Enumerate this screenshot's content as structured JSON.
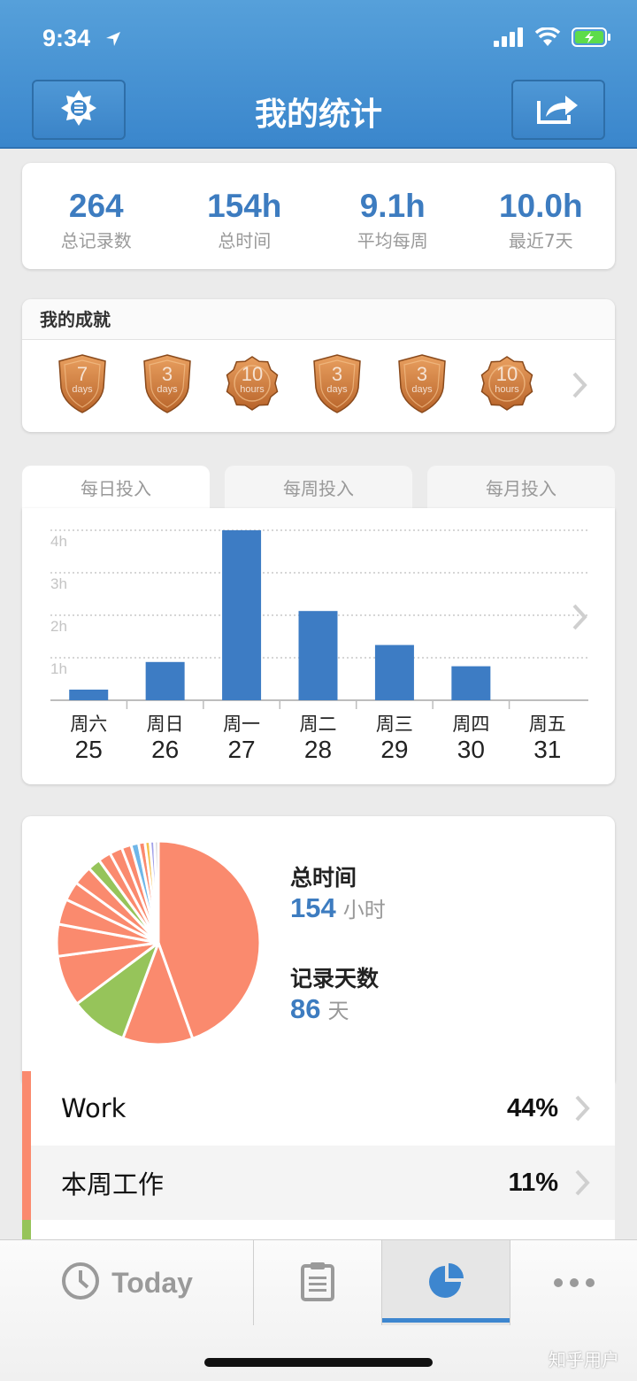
{
  "status": {
    "time": "9:34"
  },
  "header": {
    "title": "我的统计"
  },
  "summary": [
    {
      "value": "264",
      "label": "总记录数"
    },
    {
      "value": "154h",
      "label": "总时间"
    },
    {
      "value": "9.1h",
      "label": "平均每周"
    },
    {
      "value": "10.0h",
      "label": "最近7天"
    }
  ],
  "achievements": {
    "title": "我的成就",
    "badges": [
      {
        "kind": "shield",
        "num": "7",
        "unit": "days"
      },
      {
        "kind": "shield",
        "num": "3",
        "unit": "days"
      },
      {
        "kind": "seal",
        "num": "10",
        "unit": "hours"
      },
      {
        "kind": "shield",
        "num": "3",
        "unit": "days"
      },
      {
        "kind": "shield",
        "num": "3",
        "unit": "days"
      },
      {
        "kind": "seal",
        "num": "10",
        "unit": "hours"
      }
    ]
  },
  "tabs": [
    {
      "label": "每日投入",
      "active": true
    },
    {
      "label": "每周投入",
      "active": false
    },
    {
      "label": "每月投入",
      "active": false
    }
  ],
  "chart_data": {
    "type": "bar",
    "categories": [
      "周六",
      "周日",
      "周一",
      "周二",
      "周三",
      "周四",
      "周五"
    ],
    "dates": [
      "25",
      "26",
      "27",
      "28",
      "29",
      "30",
      "31"
    ],
    "values": [
      0.25,
      0.9,
      4.0,
      2.1,
      1.3,
      0.8,
      0
    ],
    "ylim": [
      0,
      4
    ],
    "yticks": [
      "1h",
      "2h",
      "3h",
      "4h"
    ],
    "grid": true,
    "bar_color": "#3d7cc4"
  },
  "pie": {
    "total_label": "总时间",
    "total_value": "154",
    "total_unit": "小时",
    "days_label": "记录天数",
    "days_value": "86",
    "days_unit": "天",
    "slices": [
      {
        "value": 44,
        "color": "#fa8a6e"
      },
      {
        "value": 11,
        "color": "#fa8a6e"
      },
      {
        "value": 9,
        "color": "#96c45a"
      },
      {
        "value": 8,
        "color": "#fa8a6e"
      },
      {
        "value": 5,
        "color": "#fa8a6e"
      },
      {
        "value": 4,
        "color": "#fa8a6e"
      },
      {
        "value": 3,
        "color": "#fa8a6e"
      },
      {
        "value": 3,
        "color": "#fa8a6e"
      },
      {
        "value": 2,
        "color": "#96c45a"
      },
      {
        "value": 2,
        "color": "#fa8a6e"
      },
      {
        "value": 2,
        "color": "#fa8a6e"
      },
      {
        "value": 1.5,
        "color": "#fa8a6e"
      },
      {
        "value": 1.2,
        "color": "#6fb6e8"
      },
      {
        "value": 1,
        "color": "#fa8a6e"
      },
      {
        "value": 0.8,
        "color": "#f5c04a"
      },
      {
        "value": 0.7,
        "color": "#a0a0e8"
      },
      {
        "value": 0.6,
        "color": "#d0d0d0"
      }
    ]
  },
  "categories": [
    {
      "name": "Work",
      "percent": "44%",
      "color": "#fa8a6e"
    },
    {
      "name": "本周工作",
      "percent": "11%",
      "color": "#fa8a6e"
    }
  ],
  "tabbar": {
    "today_label": "Today"
  },
  "watermark": "知乎用户"
}
